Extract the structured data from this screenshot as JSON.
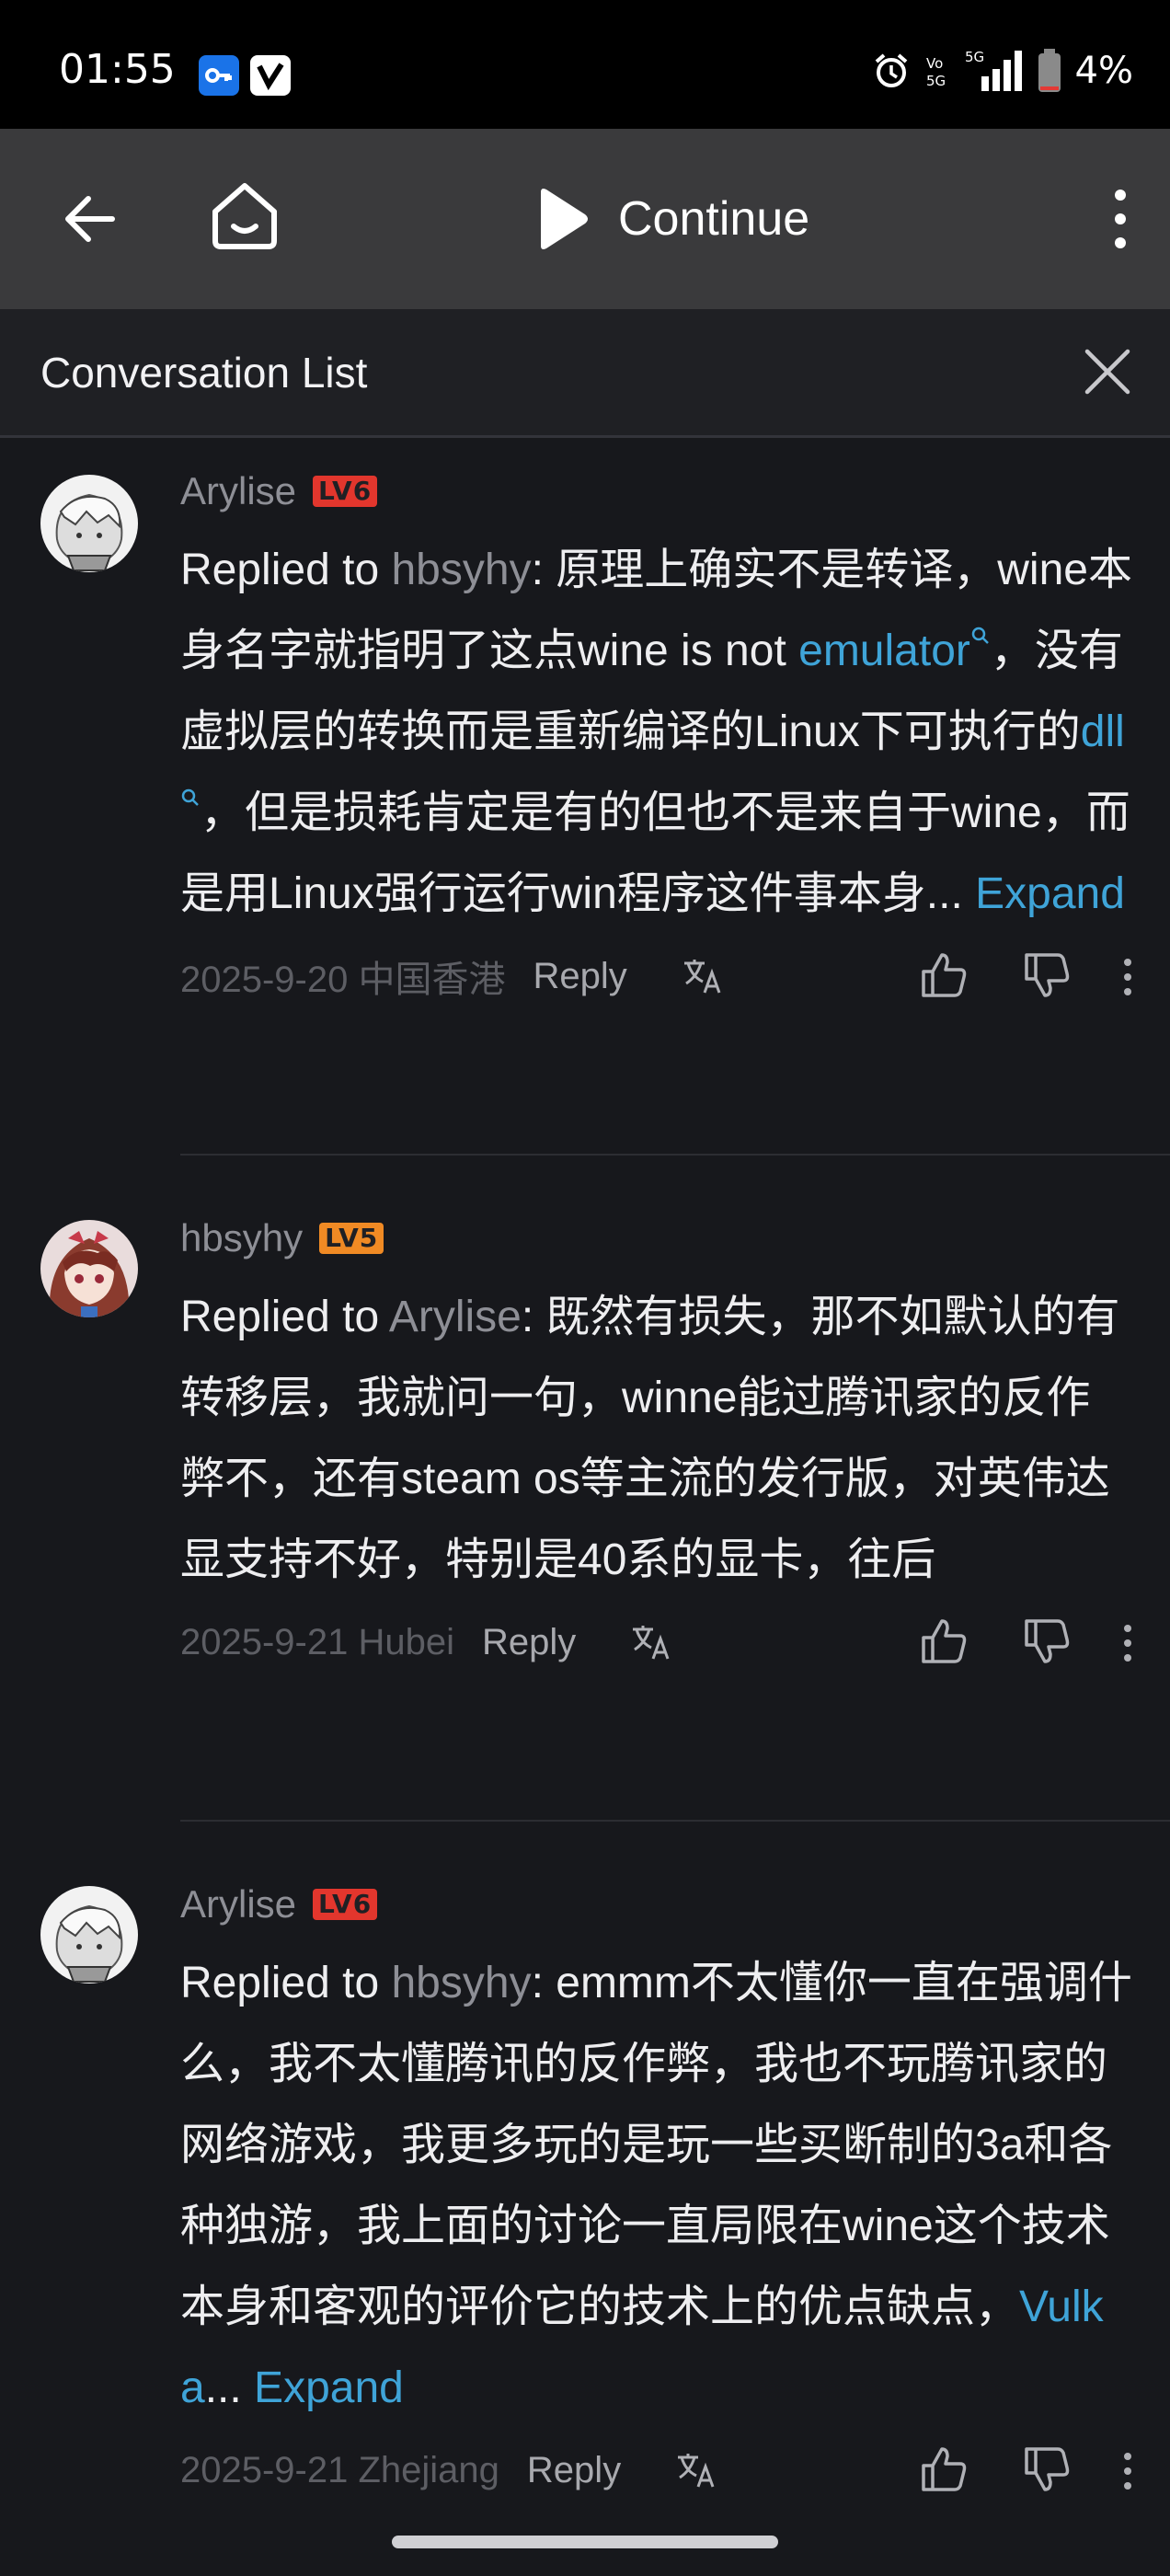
{
  "status_bar": {
    "time": "01:55",
    "network": "5G",
    "battery": "4%"
  },
  "toolbar": {
    "continue_label": "Continue"
  },
  "conversation": {
    "title": "Conversation List"
  },
  "comments": [
    {
      "username": "Arylise",
      "level": "LV6",
      "reply_prefix": "Replied to ",
      "reply_to": "hbsyhy",
      "text_1": ": 原理上确实不是转译，wine本身名字就指明了这点wine is not ",
      "link_1": "emulator",
      "text_2": "，没有虚拟层的转换而是重新编译的Linux下可执行的",
      "link_2": "dll",
      "text_3": "，但是损耗肯定是有的但也不是来自于wine，而是用Linux强行运行win程序这件事本身...",
      "expand": " Expand",
      "date": "2025-9-20 中国香港",
      "reply_label": "Reply"
    },
    {
      "username": "hbsyhy",
      "level": "LV5",
      "reply_prefix": "Replied to ",
      "reply_to": "Arylise",
      "text_1": ": 既然有损失，那不如默认的有转移层，我就问一句，winne能过腾讯家的反作弊不，还有steam os等主流的发行版，对英伟达显支持不好，特别是40系的显卡，往后",
      "date": "2025-9-21 Hubei",
      "reply_label": "Reply"
    },
    {
      "username": "Arylise",
      "level": "LV6",
      "reply_prefix": "Replied to ",
      "reply_to": "hbsyhy",
      "text_1": ": emmm不太懂你一直在强调什么，我不太懂腾讯的反作弊，我也不玩腾讯家的网络游戏，我更多玩的是玩一些买断制的3a和各种独游，我上面的讨论一直局限在wine这个技术本身和客观的评价它的技术上的优点缺点，",
      "link_1": "Vulka",
      "text_2": "...",
      "expand": " Expand",
      "date": "2025-9-21 Zhejiang",
      "reply_label": "Reply"
    }
  ],
  "colors": {
    "link": "#3fa4d8",
    "lv6": "#e2362d",
    "lv5": "#f08a24",
    "background": "#17181c"
  }
}
